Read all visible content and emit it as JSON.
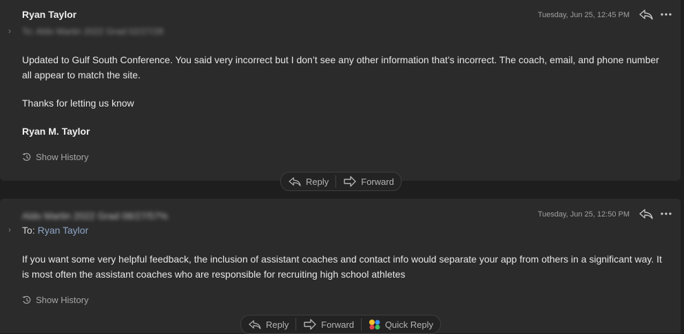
{
  "messages": [
    {
      "sender": "Ryan Taylor",
      "to_label": "To:",
      "to_blurred": "Aldo Martin 2022 Grad 02/27/28",
      "timestamp": "Tuesday, Jun 25, 12:45 PM",
      "body_p1": "Updated to Gulf South Conference. You said very incorrect but I don’t see any other information that’s incorrect. The coach, email, and phone number all appear to match the site.",
      "body_p2": "Thanks for letting us know",
      "signature": "Ryan M. Taylor",
      "show_history": "Show History",
      "reply": "Reply",
      "forward": "Forward"
    },
    {
      "sender_blurred": "Aldo Martin 2022 Grad 08/27/57%",
      "to_label": "To:",
      "to_name": "Ryan Taylor",
      "timestamp": "Tuesday, Jun 25, 12:50 PM",
      "body_p1": "If you want some very helpful feedback, the inclusion of assistant coaches and contact info would separate your app from others in a significant way.  It is most often the assistant coaches who are responsible for recruiting high school athletes",
      "show_history": "Show History",
      "reply": "Reply",
      "forward": "Forward",
      "quick_reply": "Quick Reply"
    }
  ],
  "icons": {
    "reply": "reply-arrow-icon",
    "forward": "forward-arrow-icon",
    "more": "more-ellipsis-icon",
    "history": "history-clock-icon",
    "chevron": "chevron-right-icon",
    "quick_reply": "emoji-quick-reply-icon"
  }
}
